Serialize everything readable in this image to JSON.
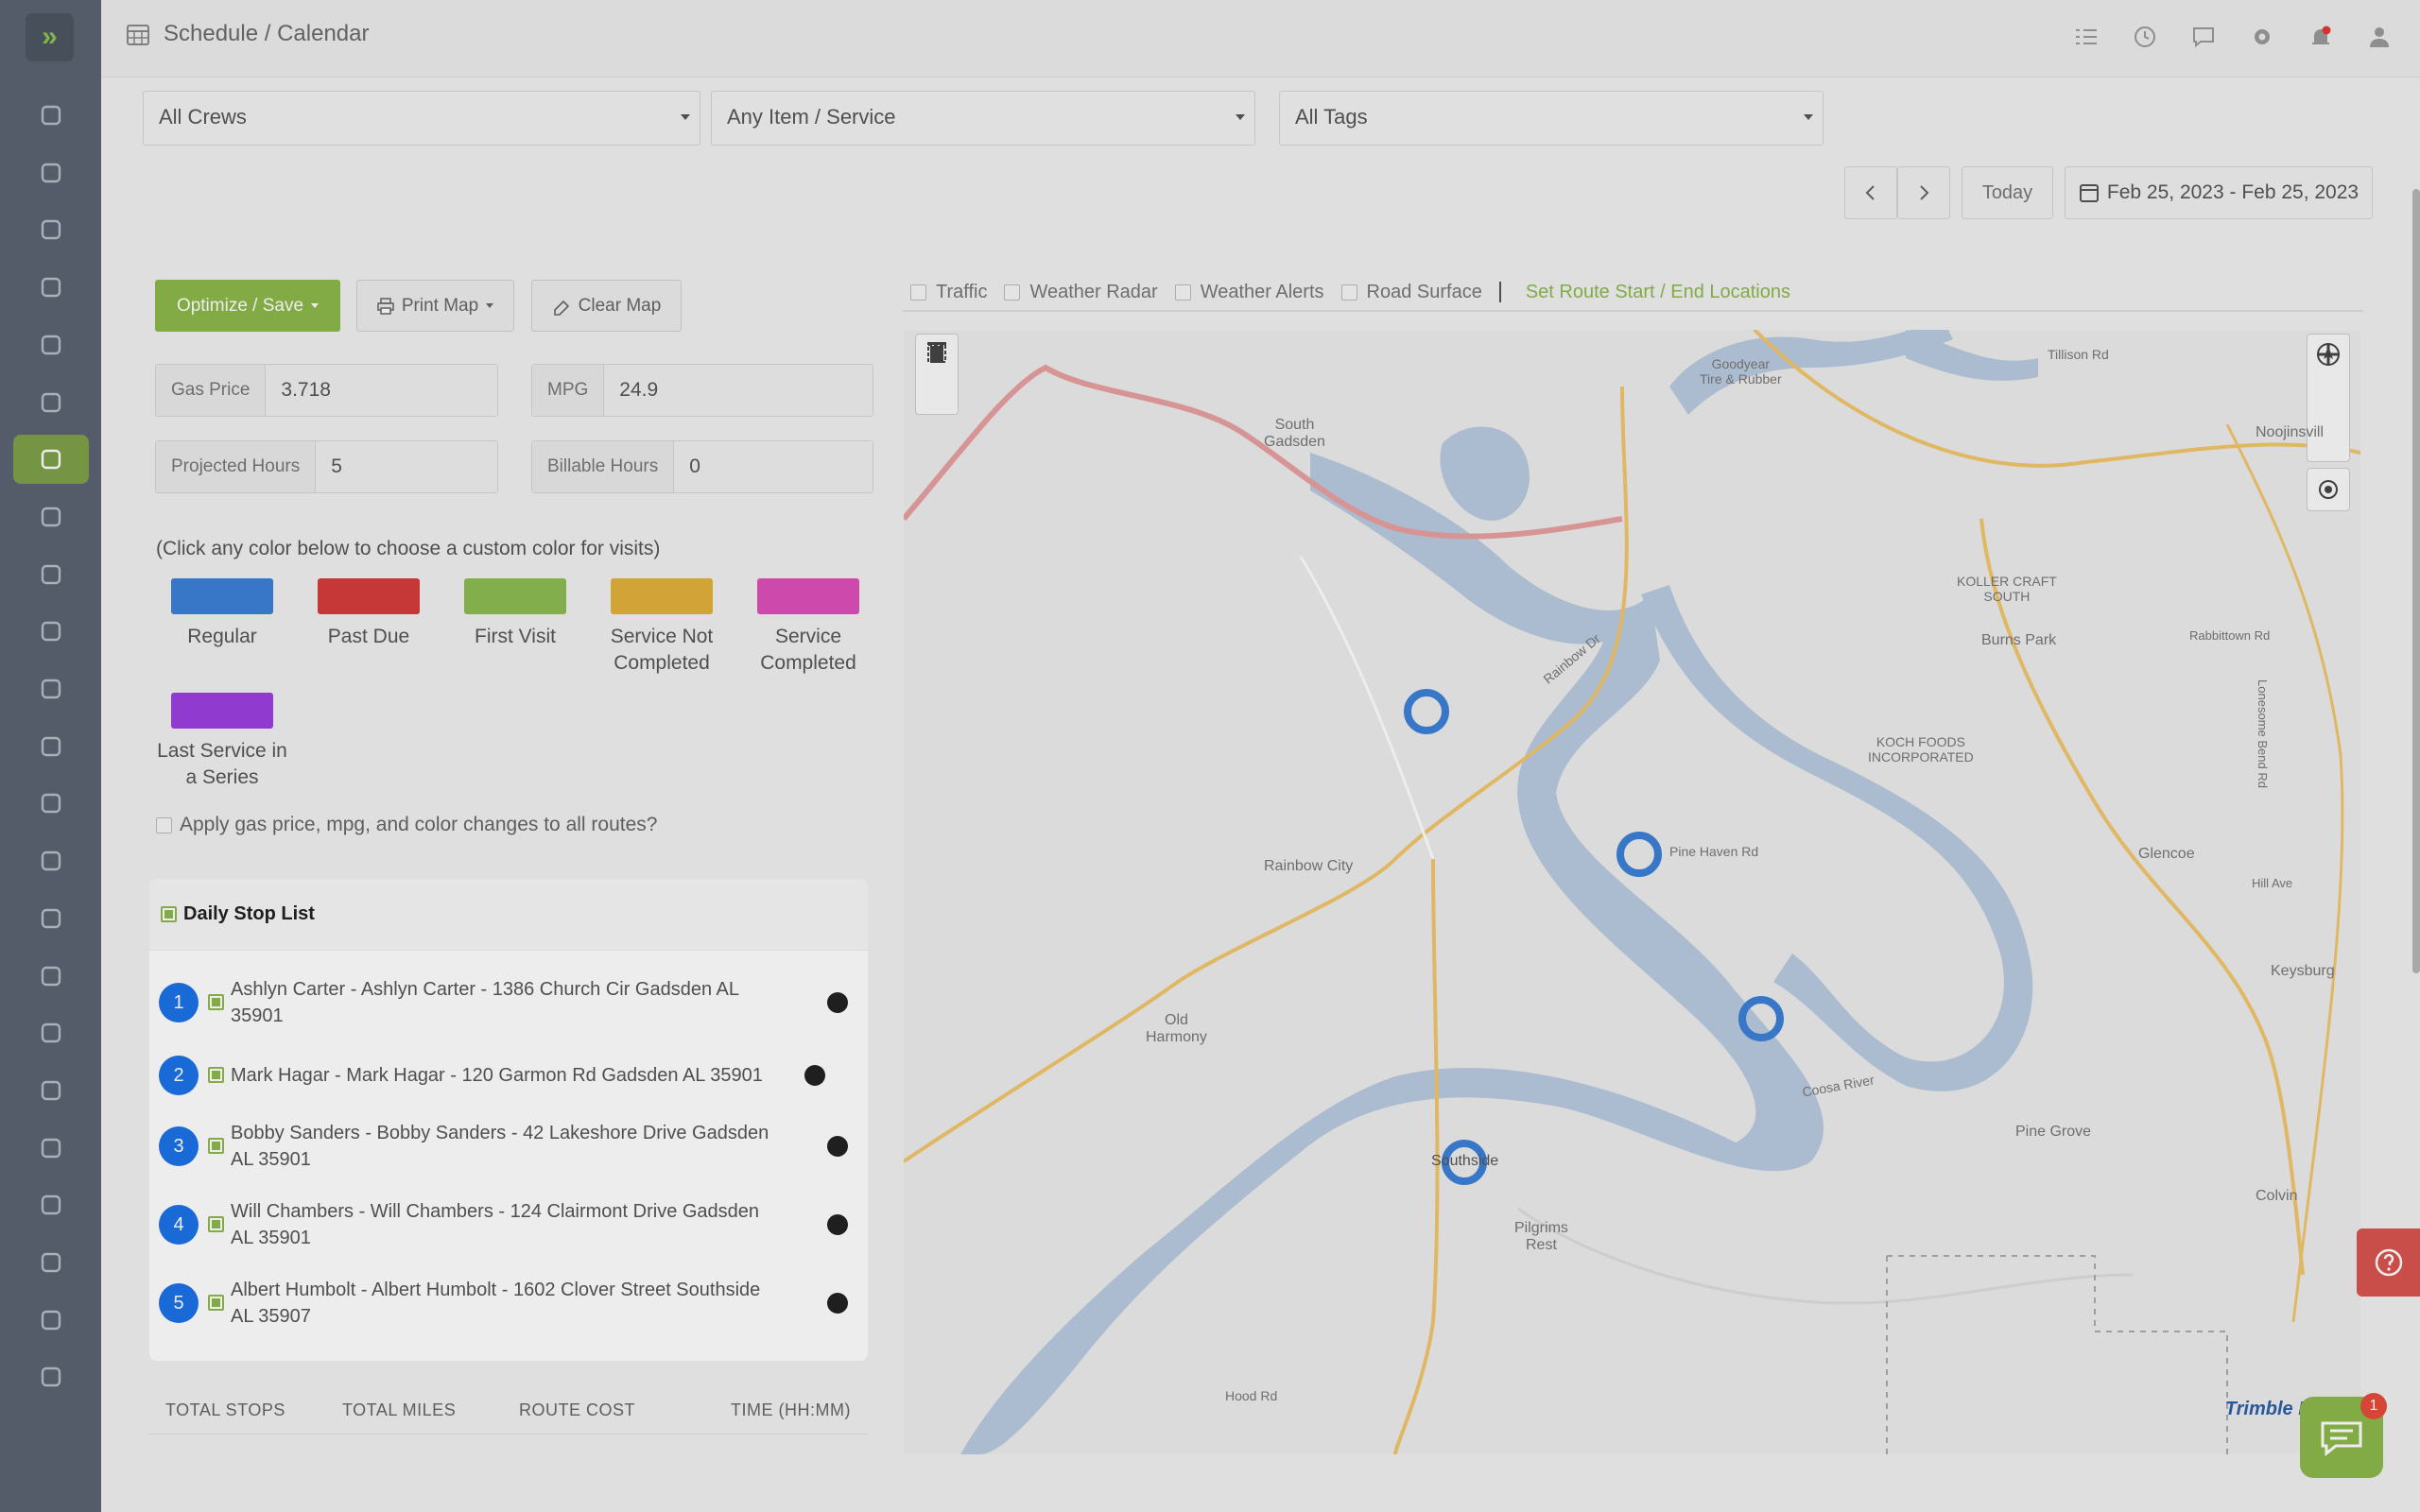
{
  "header": {
    "breadcrumb": "Schedule / Calendar"
  },
  "sidebar": {
    "items": [
      "rocket-icon",
      "support-icon",
      "monitor-icon",
      "team-icon",
      "box-icon",
      "settings-icon",
      "calendar-icon",
      "list-icon",
      "clipboard-icon",
      "clock-icon",
      "dollar-icon",
      "flask-icon",
      "document-icon",
      "edit-document-icon",
      "bar-chart-icon",
      "chat-icon",
      "phone-icon",
      "archive-icon",
      "calculator-icon",
      "database-icon",
      "message-icon",
      "mail-icon",
      "leaf-icon"
    ],
    "active": "calendar-icon"
  },
  "filters": {
    "crews": "All Crews",
    "items": "Any Item / Service",
    "tags": "All Tags"
  },
  "date_nav": {
    "today": "Today",
    "range": "Feb 25, 2023 - Feb 25, 2023"
  },
  "actions": {
    "optimize": "Optimize / Save",
    "print": "Print Map",
    "clear": "Clear Map"
  },
  "inputs": {
    "gas_label": "Gas Price",
    "gas_value": "3.718",
    "mpg_label": "MPG",
    "mpg_value": "24.9",
    "projected_label": "Projected Hours",
    "projected_value": "5",
    "billable_label": "Billable Hours",
    "billable_value": "0"
  },
  "colors_hint": "(Click any color below to choose a custom color for visits)",
  "swatches": [
    {
      "label": "Regular",
      "color": "#3d7fd8"
    },
    {
      "label": "Past Due",
      "color": "#d53c3c"
    },
    {
      "label": "First Visit",
      "color": "#8cbd52"
    },
    {
      "label": "Service Not Completed",
      "color": "#e2b13c"
    },
    {
      "label": "Service Completed",
      "color": "#dd4fb8"
    },
    {
      "label": "Last Service in a Series",
      "color": "#9b3fe0"
    }
  ],
  "swatch_labels": {
    "s0": "Regular",
    "s1": "Past Due",
    "s2": "First Visit",
    "s3a": "Service Not",
    "s3b": "Completed",
    "s4a": "Service",
    "s4b": "Completed",
    "s5a": "Last Service in",
    "s5b": "a Series"
  },
  "apply_all": "Apply gas price, mpg, and color changes to all routes?",
  "stop_list": {
    "title": "Daily Stop List",
    "stops": [
      {
        "n": "1",
        "l1": "Ashlyn Carter - Ashlyn Carter - 1386 Church Cir Gadsden AL",
        "l2": "35901"
      },
      {
        "n": "2",
        "l1": "Mark Hagar - Mark Hagar - 120 Garmon Rd Gadsden AL 35901",
        "l2": ""
      },
      {
        "n": "3",
        "l1": "Bobby Sanders - Bobby Sanders - 42 Lakeshore Drive Gadsden",
        "l2": "AL 35901"
      },
      {
        "n": "4",
        "l1": "Will Chambers - Will Chambers - 124 Clairmont Drive Gadsden",
        "l2": "AL 35901"
      },
      {
        "n": "5",
        "l1": "Albert Humbolt - Albert Humbolt - 1602 Clover Street Southside",
        "l2": "AL 35907"
      }
    ]
  },
  "totals": {
    "stops": "TOTAL STOPS",
    "miles": "TOTAL MILES",
    "cost": "ROUTE COST",
    "time": "TIME (HH:MM)"
  },
  "map_toolbar": {
    "traffic": "Traffic",
    "radar": "Weather Radar",
    "alerts": "Weather Alerts",
    "road": "Road Surface",
    "route": "Set Route Start / End Locations"
  },
  "map": {
    "places": {
      "south_gadsden_a": "South",
      "south_gadsden_b": "Gadsden",
      "goodyear_a": "Goodyear",
      "goodyear_b": "Tire & Rubber",
      "tillison": "Tillison Rd",
      "noojinsvill": "Noojinsvill",
      "koller_a": "KOLLER CRAFT",
      "koller_b": "SOUTH",
      "burns_park": "Burns Park",
      "koch_a": "KOCH FOODS",
      "koch_b": "INCORPORATED",
      "rainbow_city": "Rainbow City",
      "pine_haven": "Pine Haven Rd",
      "glencoe": "Glencoe",
      "hill_ave": "Hill Ave",
      "keysburg": "Keysburg",
      "old_harmony_a": "Old",
      "old_harmony_b": "Harmony",
      "southside": "Southside",
      "pilgrims_a": "Pilgrims",
      "pilgrims_b": "Rest",
      "pine_grove": "Pine Grove",
      "colvin": "Colvin",
      "coosa_river": "Coosa River",
      "rainbow_dr": "Rainbow Dr",
      "hood_rd": "Hood Rd",
      "rabbittown": "Rabbittown Rd",
      "lonesome": "Lonesome Bend Rd"
    },
    "attribution": "Trimble MAPS"
  },
  "chat_badge": "1"
}
